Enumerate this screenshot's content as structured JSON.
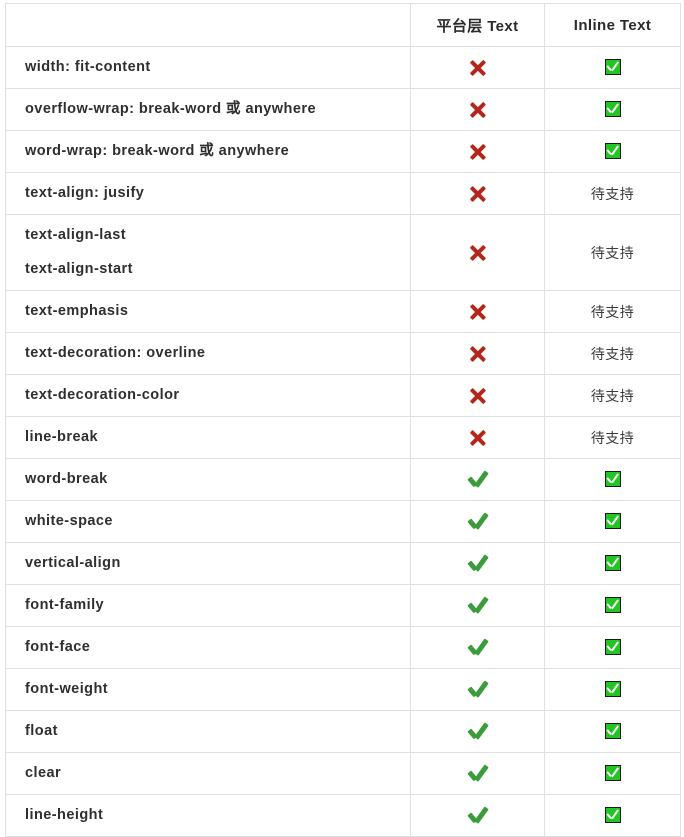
{
  "table": {
    "columns": [
      {
        "key": "property",
        "label": "",
        "align": "left"
      },
      {
        "key": "platform",
        "label": "平台层 Text",
        "align": "center"
      },
      {
        "key": "inline",
        "label": "Inline Text",
        "align": "center"
      }
    ],
    "icons": {
      "cross": "cross-mark-icon",
      "check": "heavy-check-mark-icon",
      "checkbox": "green-check-box-icon"
    },
    "status_labels": {
      "pending": "待支持"
    },
    "colors": {
      "cross": "#b3271a",
      "check": "#3a9c3a",
      "checkbox_fill": "#22c522",
      "border": "#e0e0e0",
      "text": "#2f2f2f"
    },
    "rows": [
      {
        "property": [
          "width: fit-content"
        ],
        "platform": "cross",
        "inline": "checkbox"
      },
      {
        "property": [
          "overflow-wrap: break-word 或 anywhere"
        ],
        "platform": "cross",
        "inline": "checkbox"
      },
      {
        "property": [
          "word-wrap: break-word 或 anywhere"
        ],
        "platform": "cross",
        "inline": "checkbox"
      },
      {
        "property": [
          "text-align: jusify"
        ],
        "platform": "cross",
        "inline": "待支持"
      },
      {
        "property": [
          "text-align-last",
          "text-align-start"
        ],
        "platform": "cross",
        "inline": "待支持"
      },
      {
        "property": [
          "text-emphasis"
        ],
        "platform": "cross",
        "inline": "待支持"
      },
      {
        "property": [
          "text-decoration: overline"
        ],
        "platform": "cross",
        "inline": "待支持"
      },
      {
        "property": [
          "text-decoration-color"
        ],
        "platform": "cross",
        "inline": "待支持"
      },
      {
        "property": [
          "line-break"
        ],
        "platform": "cross",
        "inline": "待支持"
      },
      {
        "property": [
          "word-break"
        ],
        "platform": "check",
        "inline": "checkbox"
      },
      {
        "property": [
          "white-space"
        ],
        "platform": "check",
        "inline": "checkbox"
      },
      {
        "property": [
          "vertical-align"
        ],
        "platform": "check",
        "inline": "checkbox"
      },
      {
        "property": [
          "font-family"
        ],
        "platform": "check",
        "inline": "checkbox"
      },
      {
        "property": [
          "font-face"
        ],
        "platform": "check",
        "inline": "checkbox"
      },
      {
        "property": [
          "font-weight"
        ],
        "platform": "check",
        "inline": "checkbox"
      },
      {
        "property": [
          "float"
        ],
        "platform": "check",
        "inline": "checkbox"
      },
      {
        "property": [
          "clear"
        ],
        "platform": "check",
        "inline": "checkbox"
      },
      {
        "property": [
          "line-height"
        ],
        "platform": "check",
        "inline": "checkbox"
      }
    ]
  }
}
